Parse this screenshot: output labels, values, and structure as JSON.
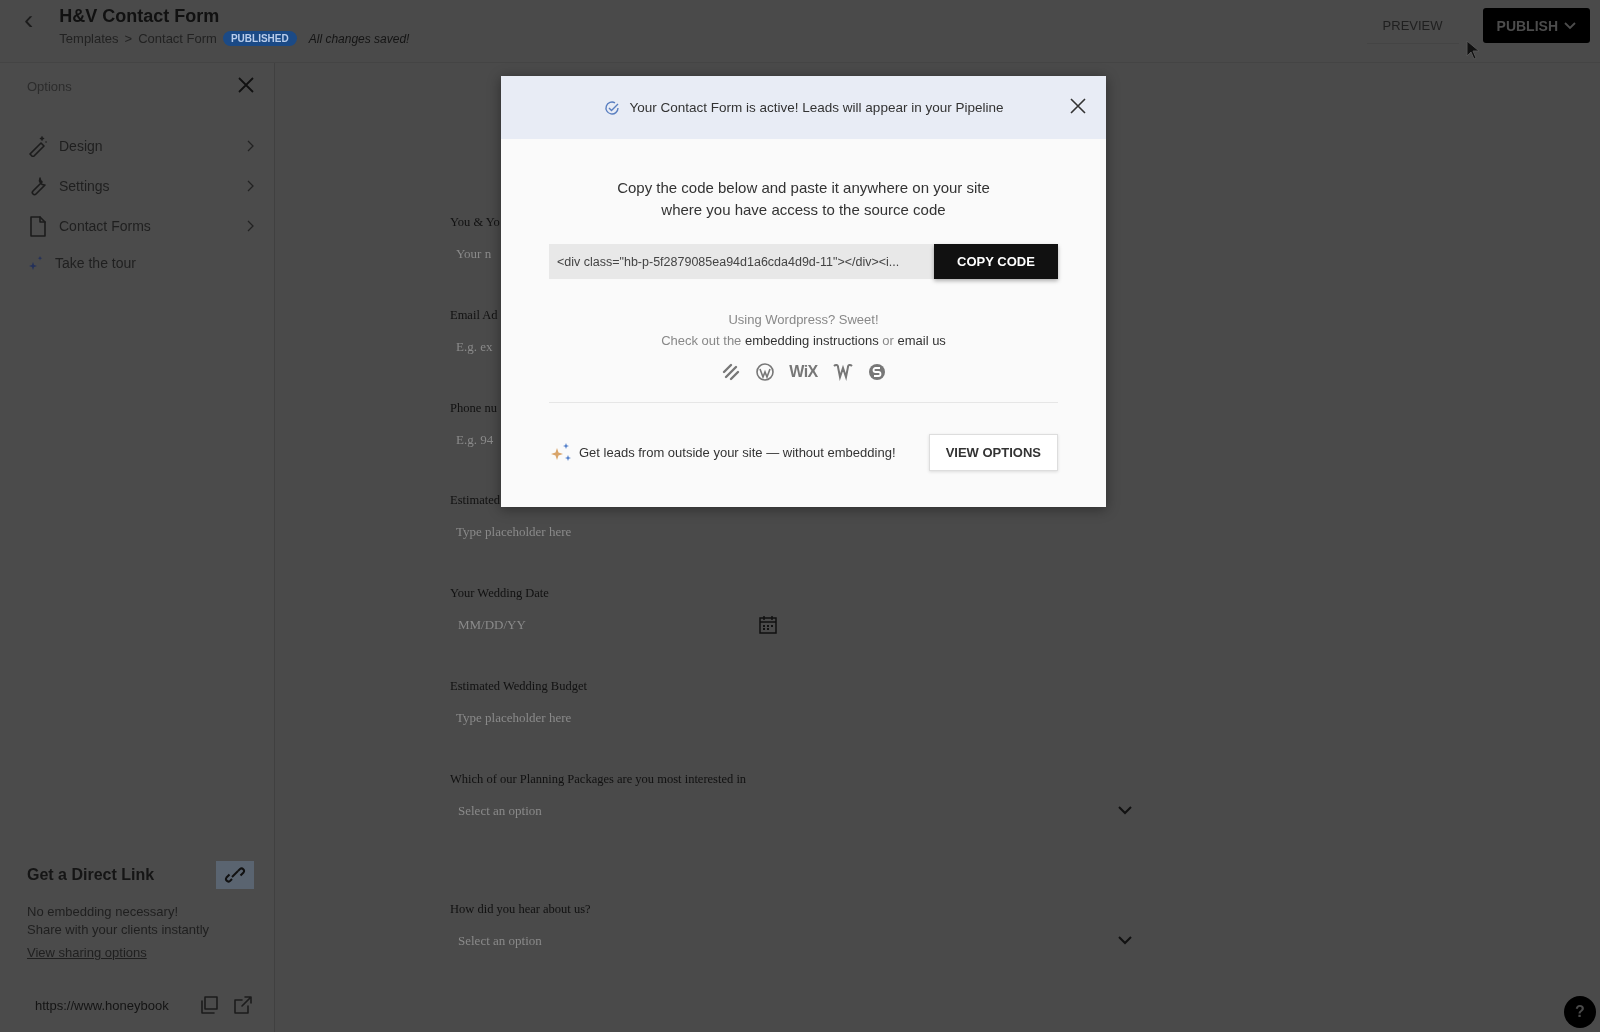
{
  "header": {
    "back": "‹",
    "title": "H&V Contact Form",
    "breadcrumbs": [
      "Templates",
      "Contact Form"
    ],
    "separator": ">",
    "status_badge": "PUBLISHED",
    "save_status": "All changes saved!",
    "preview_button": "PREVIEW",
    "publish_button": "PUBLISH"
  },
  "sidebar": {
    "title": "Options",
    "items": [
      {
        "label": "Design",
        "kind": "design"
      },
      {
        "label": "Settings",
        "kind": "settings"
      },
      {
        "label": "Contact Forms",
        "kind": "forms"
      }
    ],
    "tour": "Take the tour",
    "direct_link": {
      "title": "Get a Direct Link",
      "lines": [
        "No embedding necessary!",
        "Share with your clients instantly"
      ],
      "link": "View sharing options",
      "url": "https://www.honeybook"
    }
  },
  "form": {
    "fields": [
      {
        "label": "You & Yo",
        "placeholder": "Your n",
        "kind": "text"
      },
      {
        "label": "Email Ad",
        "placeholder": "E.g. ex",
        "kind": "text"
      },
      {
        "label": "Phone nu",
        "placeholder": "E.g. 94",
        "kind": "text"
      },
      {
        "label": "Estimated",
        "placeholder": "Type placeholder here",
        "kind": "text"
      },
      {
        "label": "Your Wedding Date",
        "placeholder": "MM/DD/YY",
        "kind": "date"
      },
      {
        "label": "Estimated Wedding Budget",
        "placeholder": "Type placeholder here",
        "kind": "text"
      },
      {
        "label": "Which of our Planning Packages are you most interested in",
        "placeholder": "Select an option",
        "kind": "select"
      },
      {
        "label": "How did you hear about us?",
        "placeholder": "Select an option",
        "kind": "select"
      }
    ]
  },
  "modal": {
    "banner": "Your Contact Form is active! Leads will appear in your Pipeline",
    "instructions": [
      "Copy the code below and paste it anywhere on your site",
      "where you have access to the source code"
    ],
    "code": "<div class=\"hb-p-5f2879085ea94d1a6cda4d9d-11\"></div><i...",
    "copy_button": "COPY CODE",
    "wordpress_note": "Using Wordpress? Sweet!",
    "help_prefix": "Check out the",
    "help_link": "embedding instructions",
    "help_or": "or",
    "help_email": "email us",
    "platforms": [
      {
        "kind": "squarespace"
      },
      {
        "kind": "wordpress"
      },
      {
        "kind": "wix",
        "label": "WiX"
      },
      {
        "kind": "weebly"
      },
      {
        "kind": "other"
      }
    ],
    "promo": "Get leads from outside your site — without embedding!",
    "view_options_button": "VIEW OPTIONS"
  },
  "help_button": "?"
}
